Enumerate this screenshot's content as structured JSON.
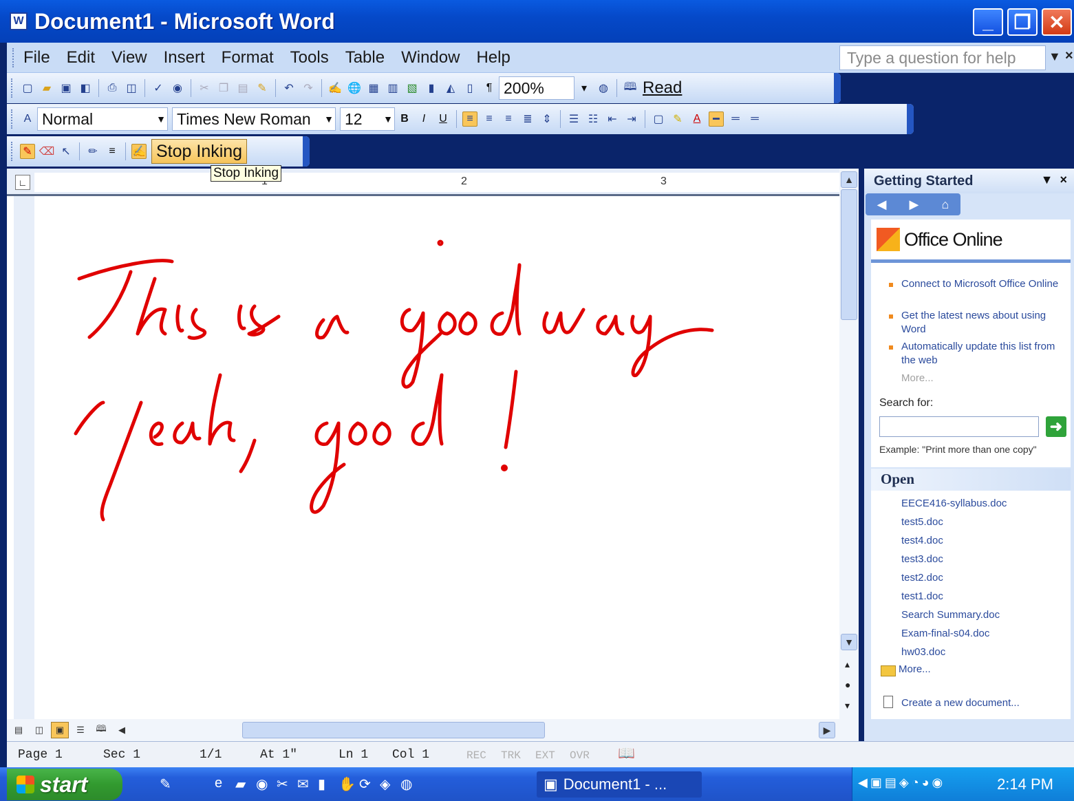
{
  "window": {
    "title": "Document1 - Microsoft Word",
    "app_icon": "W"
  },
  "menubar": {
    "items": [
      "File",
      "Edit",
      "View",
      "Insert",
      "Format",
      "Tools",
      "Table",
      "Window",
      "Help"
    ],
    "help_placeholder": "Type a question for help"
  },
  "standard_toolbar": {
    "zoom": "200%",
    "read_label": "Read"
  },
  "formatting_toolbar": {
    "style": "Normal",
    "font": "Times New Roman",
    "size": "12"
  },
  "ink_toolbar": {
    "stop_label": "Stop Inking",
    "tooltip": "Stop Inking",
    "ink_color": "#e00000"
  },
  "ruler": {
    "numbers": [
      "1",
      "2",
      "3"
    ]
  },
  "document": {
    "ink_line1": "This is a good way",
    "ink_line2": "Yeah, good!"
  },
  "taskpane": {
    "title": "Getting Started",
    "logo_text": "Office Online",
    "links": [
      "Connect to Microsoft Office Online",
      "Get the latest news about using Word",
      "Automatically update this list from the web"
    ],
    "more": "More...",
    "search_label": "Search for:",
    "example": "Example:  \"Print more than one copy\"",
    "open_heading": "Open",
    "files": [
      "EECE416-syllabus.doc",
      "test5.doc",
      "test4.doc",
      "test3.doc",
      "test2.doc",
      "test1.doc",
      "Search Summary.doc",
      "Exam-final-s04.doc",
      "hw03.doc"
    ],
    "open_more": "More...",
    "create_new": "Create a new document..."
  },
  "statusbar": {
    "page": "Page 1",
    "sec": "Sec 1",
    "pages": "1/1",
    "at": "At 1\"",
    "ln": "Ln 1",
    "col": "Col 1",
    "rec": "REC",
    "trk": "TRK",
    "ext": "EXT",
    "ovr": "OVR"
  },
  "taskbar": {
    "start": "start",
    "task_doc": "Document1 - ...",
    "clock": "2:14 PM"
  }
}
